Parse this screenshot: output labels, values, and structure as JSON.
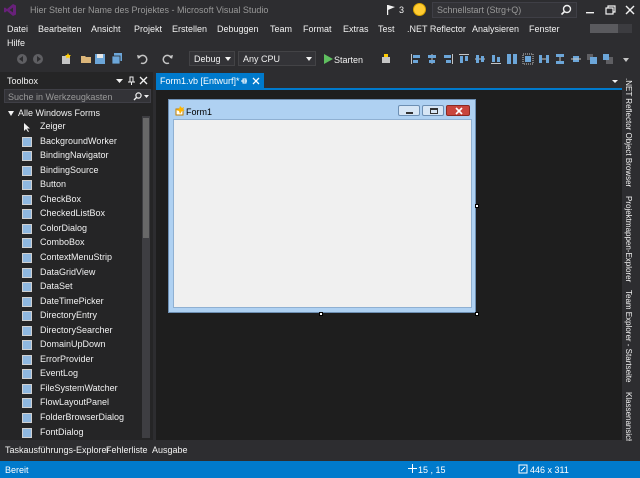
{
  "window": {
    "title": "Hier Steht der Name des Projektes - Microsoft Visual Studio",
    "notification_count": "3",
    "quick_launch_placeholder": "Schnellstart (Strg+Q)"
  },
  "menu": {
    "items": [
      "Datei",
      "Bearbeiten",
      "Ansicht",
      "Projekt",
      "Erstellen",
      "Debuggen",
      "Team",
      "Format",
      "Extras",
      "Test",
      ".NET Reflector",
      "Analysieren",
      "Fenster"
    ],
    "second_row": "Hilfe"
  },
  "toolbar": {
    "config": "Debug",
    "platform": "Any CPU",
    "start_label": "Starten"
  },
  "toolbox": {
    "title": "Toolbox",
    "search_placeholder": "Suche in Werkzeugkasten",
    "category": "Alle Windows Forms",
    "items": [
      {
        "label": "Zeiger",
        "icon": "pointer-icon"
      },
      {
        "label": "BackgroundWorker",
        "icon": "component-icon"
      },
      {
        "label": "BindingNavigator",
        "icon": "navigator-icon"
      },
      {
        "label": "BindingSource",
        "icon": "bindingsource-icon"
      },
      {
        "label": "Button",
        "icon": "button-icon"
      },
      {
        "label": "CheckBox",
        "icon": "checkbox-icon"
      },
      {
        "label": "CheckedListBox",
        "icon": "checkedlistbox-icon"
      },
      {
        "label": "ColorDialog",
        "icon": "colordialog-icon"
      },
      {
        "label": "ComboBox",
        "icon": "combobox-icon"
      },
      {
        "label": "ContextMenuStrip",
        "icon": "contextmenu-icon"
      },
      {
        "label": "DataGridView",
        "icon": "datagrid-icon"
      },
      {
        "label": "DataSet",
        "icon": "dataset-icon"
      },
      {
        "label": "DateTimePicker",
        "icon": "datetimepicker-icon"
      },
      {
        "label": "DirectoryEntry",
        "icon": "directoryentry-icon"
      },
      {
        "label": "DirectorySearcher",
        "icon": "directorysearcher-icon"
      },
      {
        "label": "DomainUpDown",
        "icon": "domainupdown-icon"
      },
      {
        "label": "ErrorProvider",
        "icon": "errorprovider-icon"
      },
      {
        "label": "EventLog",
        "icon": "eventlog-icon"
      },
      {
        "label": "FileSystemWatcher",
        "icon": "filesystemwatcher-icon"
      },
      {
        "label": "FlowLayoutPanel",
        "icon": "flowlayoutpanel-icon"
      },
      {
        "label": "FolderBrowserDialog",
        "icon": "folderbrowser-icon"
      },
      {
        "label": "FontDialog",
        "icon": "fontdialog-icon"
      }
    ]
  },
  "editor": {
    "tab_label": "Form1.vb [Entwurf]*",
    "form_caption": "Form1"
  },
  "right_tabs": [
    ".NET Reflector Object Browser",
    "Projektmappen-Explorer",
    "Team Explorer - Startseite",
    "Klassenansicht"
  ],
  "bottom_tabs": [
    "Taskausführungs-Explorer",
    "Fehlerliste",
    "Ausgabe"
  ],
  "status": {
    "text": "Bereit",
    "position": "15 , 15",
    "size": "446 x 311"
  },
  "colors": {
    "accent": "#007acc",
    "background": "#2d2d30",
    "panel": "#252526",
    "editor": "#1e1e1e"
  }
}
